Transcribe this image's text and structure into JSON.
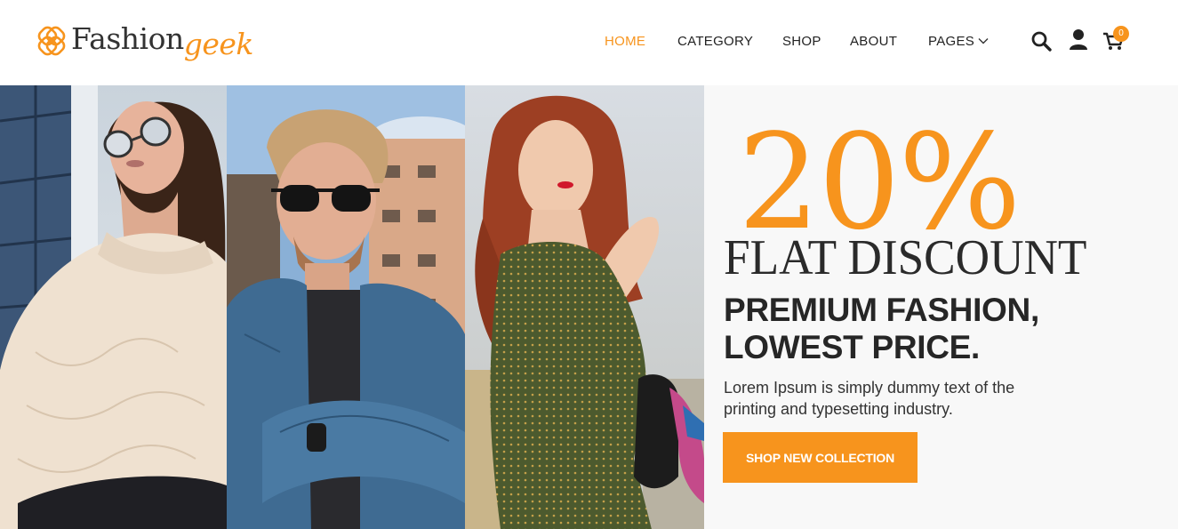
{
  "brand": {
    "name_part1": "Fashion",
    "name_part2": "geek",
    "accent_color": "#f7941d",
    "logo_icon": "interlocking-ring-icon"
  },
  "nav": {
    "items": [
      {
        "label": "HOME",
        "active": true
      },
      {
        "label": "CATEGORY",
        "active": false
      },
      {
        "label": "SHOP",
        "active": false
      },
      {
        "label": "ABOUT",
        "active": false
      },
      {
        "label": "PAGES",
        "active": false,
        "has_dropdown": true
      }
    ]
  },
  "header_icons": {
    "search": "search-icon",
    "account": "user-icon",
    "cart": "cart-icon",
    "cart_count": "0"
  },
  "hero": {
    "images": [
      {
        "name": "woman-white-sweater-sunglasses-photo"
      },
      {
        "name": "man-denim-jacket-sunglasses-photo"
      },
      {
        "name": "redhead-woman-green-dress-photo"
      }
    ],
    "discount": "20%",
    "discount_label": "FLAT DISCOUNT",
    "headline_line1": "PREMIUM FASHION,",
    "headline_line2": "LOWEST PRICE.",
    "description": "Lorem Ipsum is simply dummy text of the printing and typesetting industry.",
    "cta_label": "SHOP NEW COLLECTION"
  }
}
